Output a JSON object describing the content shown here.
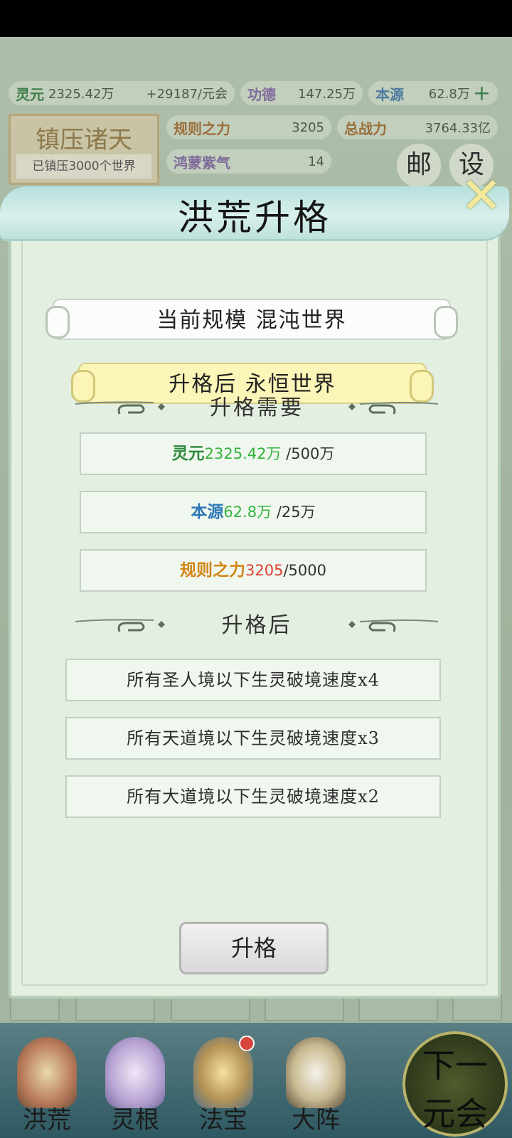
{
  "top_stats": {
    "lingyuan": {
      "label": "灵元",
      "value": "2325.42万",
      "rate": "+29187/元会"
    },
    "gongde": {
      "label": "功德",
      "value": "147.25万"
    },
    "benyuan": {
      "label": "本源",
      "value": "62.8万"
    },
    "guize": {
      "label": "规则之力",
      "value": "3205"
    },
    "zongzhanli": {
      "label": "总战力",
      "value": "3764.33亿"
    },
    "hongmeng": {
      "label": "鸿蒙紫气",
      "value": "14"
    }
  },
  "plaque": {
    "title": "镇压诸天",
    "subtitle": "已镇压3000个世界"
  },
  "round_buttons": {
    "mail": "邮",
    "settings": "设"
  },
  "dialog": {
    "title": "洪荒升格",
    "current_scale": "当前规模  混沌世界",
    "upgraded_scale": "升格后  永恒世界",
    "requirements_header": "升格需要",
    "requirements": [
      {
        "label": "灵元",
        "have": "2325.42万",
        "need": "/500万",
        "color": "#2f8a3c"
      },
      {
        "label": "本源",
        "have": "62.8万",
        "need": "/25万",
        "color": "#2c78b6"
      },
      {
        "label": "规则之力",
        "have": "3205",
        "need": "/5000",
        "color": "#d28412"
      }
    ],
    "effects_header": "升格后",
    "effects": [
      "所有圣人境以下生灵破境速度x4",
      "所有天道境以下生灵破境速度x3",
      "所有大道境以下生灵破境速度x2"
    ],
    "upgrade_button": "升格"
  },
  "bottom_nav": [
    {
      "label": "洪荒",
      "icon": "mountain-icon"
    },
    {
      "label": "灵根",
      "icon": "lotus-icon"
    },
    {
      "label": "法宝",
      "icon": "treasure-icon"
    },
    {
      "label": "大阵",
      "icon": "formation-icon"
    }
  ],
  "next_era": {
    "line1": "下一",
    "line2": "元会"
  },
  "colors": {
    "accent_green": "#36b33d",
    "warning_red": "#dd4032",
    "dialog_bg": "#e3efe0"
  }
}
